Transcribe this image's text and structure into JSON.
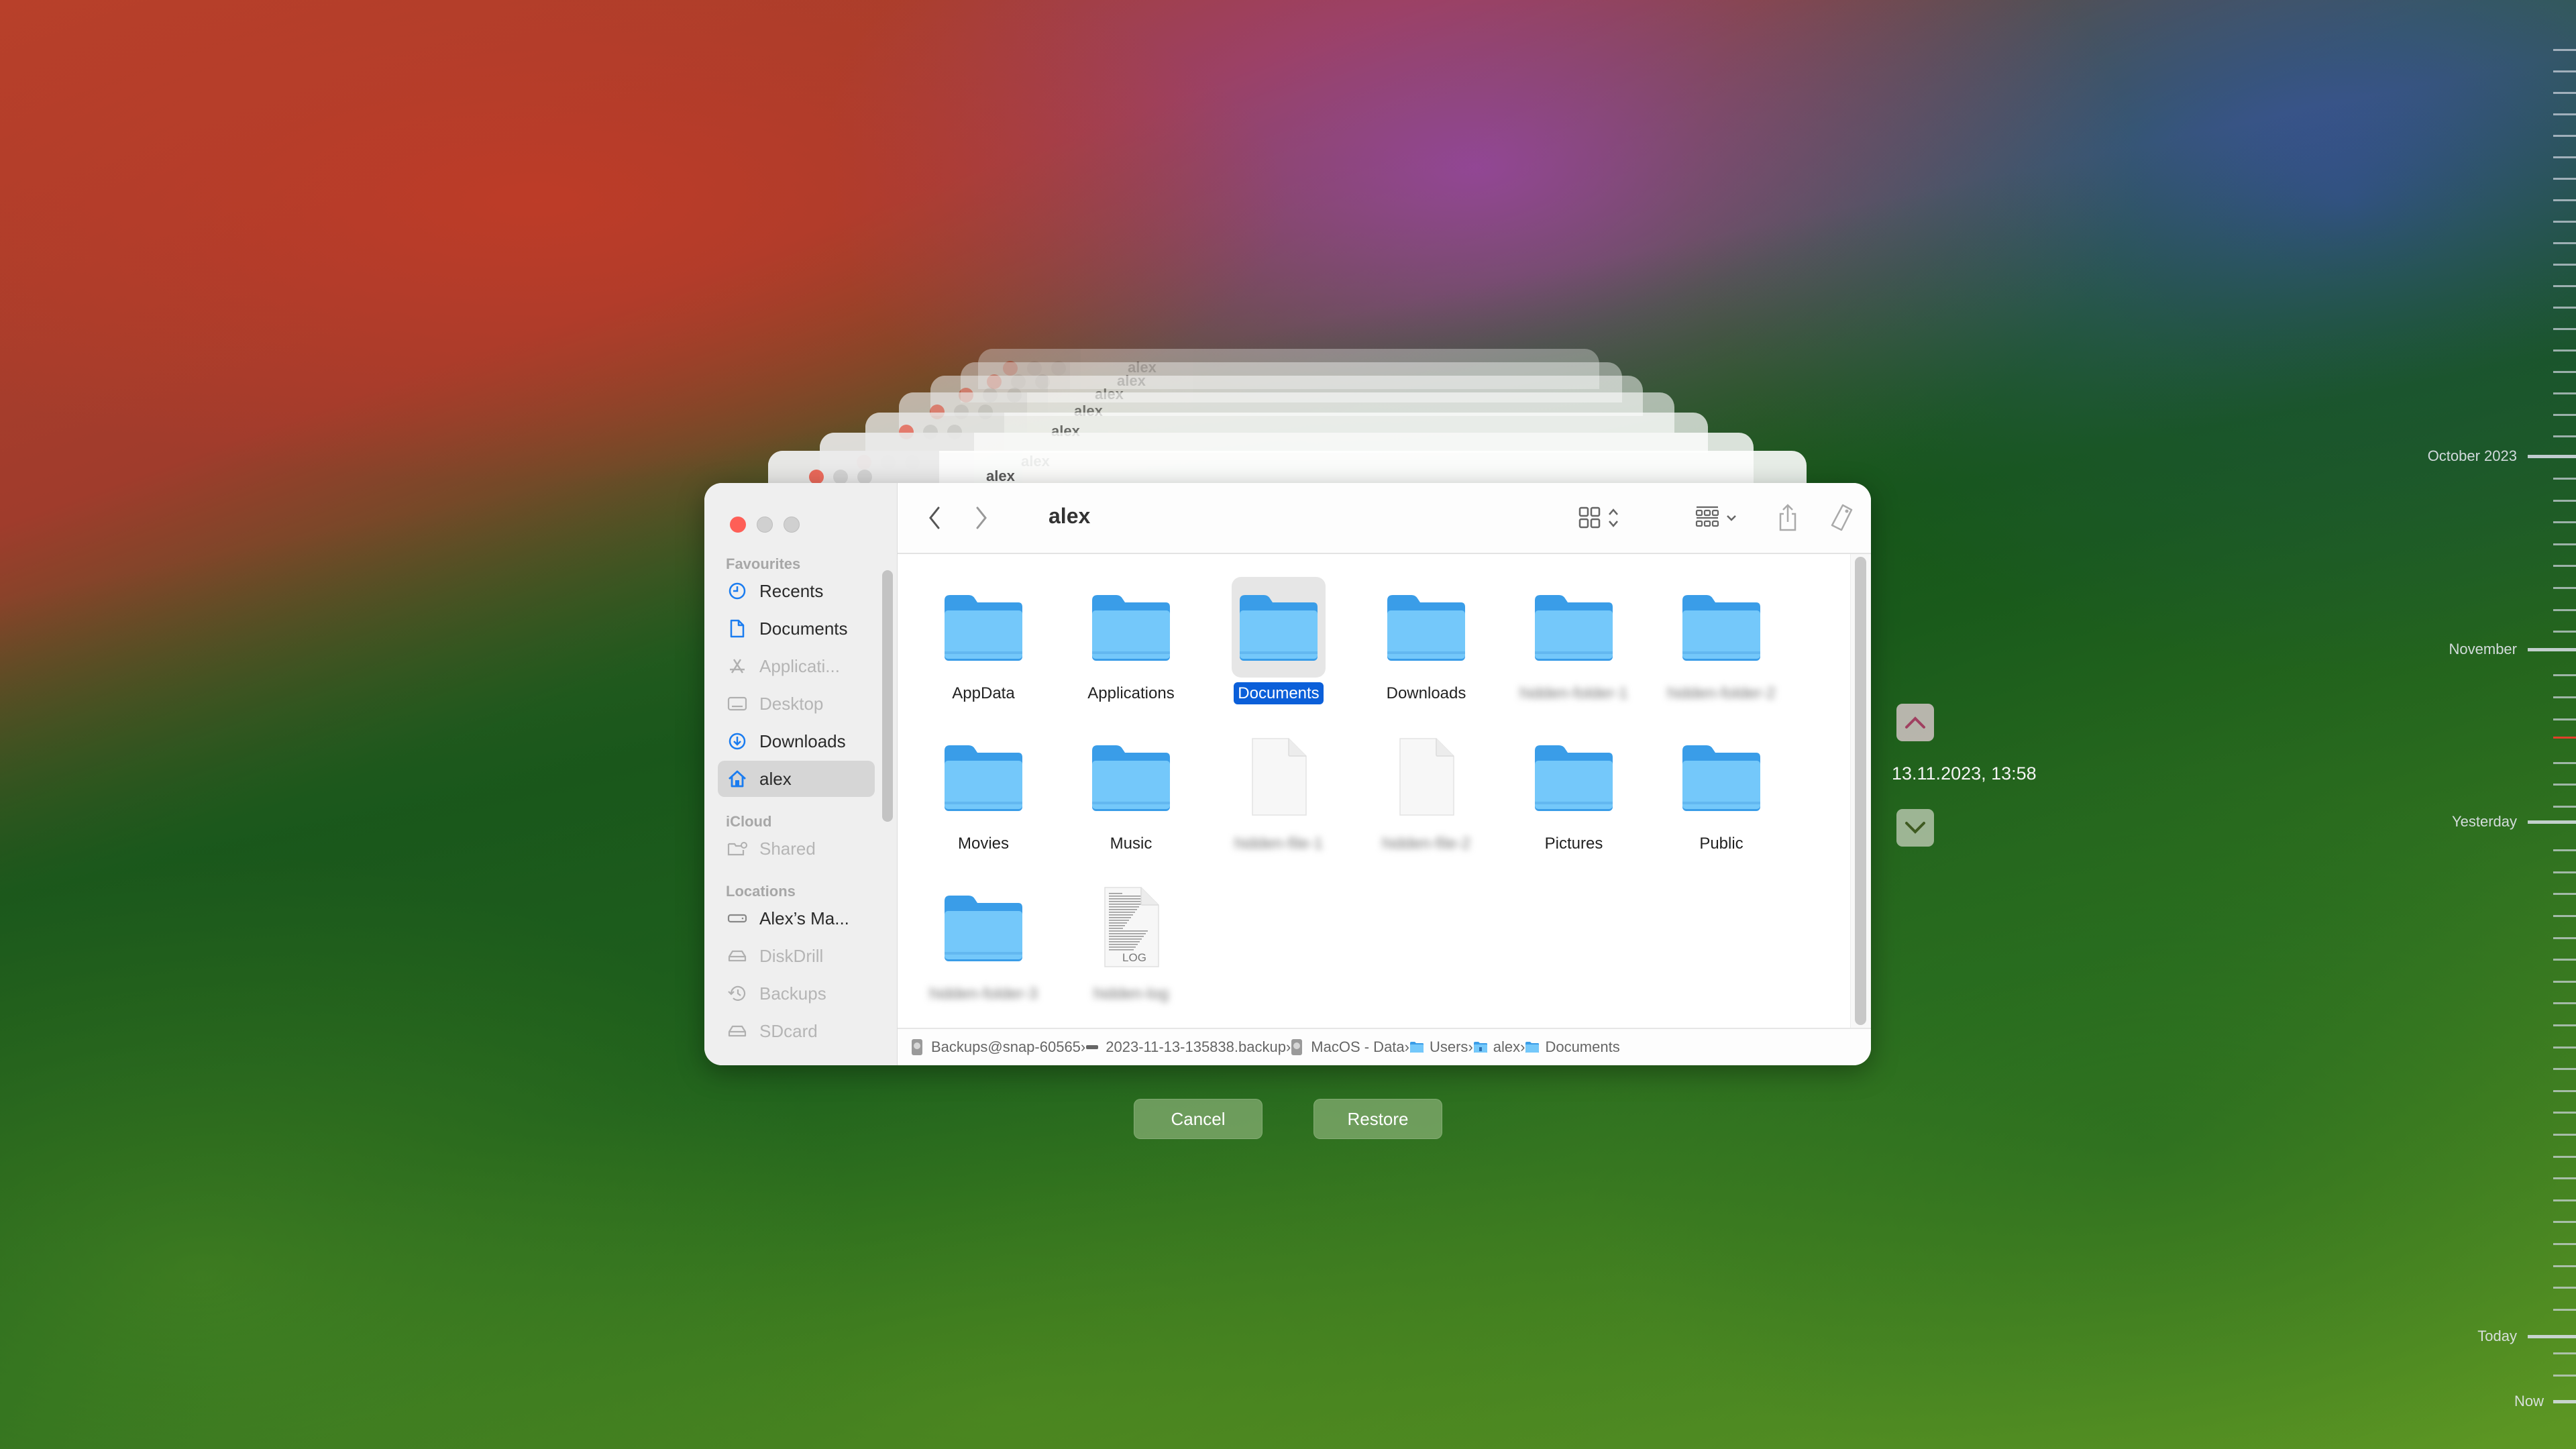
{
  "window": {
    "title": "alex",
    "sidebar": {
      "sections": [
        {
          "label": "Favourites",
          "items": [
            {
              "label": "Recents",
              "icon": "clock-icon",
              "dim": false,
              "selected": false
            },
            {
              "label": "Documents",
              "icon": "document-icon",
              "dim": false,
              "selected": false
            },
            {
              "label": "Applicati...",
              "icon": "applications-icon",
              "dim": true,
              "selected": false
            },
            {
              "label": "Desktop",
              "icon": "desktop-icon",
              "dim": true,
              "selected": false
            },
            {
              "label": "Downloads",
              "icon": "download-icon",
              "dim": false,
              "selected": false
            },
            {
              "label": "alex",
              "icon": "home-icon",
              "dim": false,
              "selected": true
            }
          ]
        },
        {
          "label": "iCloud",
          "items": [
            {
              "label": "Shared",
              "icon": "shared-folder-icon",
              "dim": true,
              "selected": false
            }
          ]
        },
        {
          "label": "Locations",
          "items": [
            {
              "label": "Alex’s Ma...",
              "icon": "computer-icon",
              "dim": false,
              "selected": false
            },
            {
              "label": "DiskDrill",
              "icon": "drive-icon",
              "dim": true,
              "selected": false
            },
            {
              "label": "Backups",
              "icon": "time-machine-icon",
              "dim": true,
              "selected": false
            },
            {
              "label": "SDcard",
              "icon": "drive-icon",
              "dim": true,
              "selected": false
            }
          ]
        }
      ]
    },
    "toolbar": {
      "back": "back-chevron-icon",
      "forward": "forward-chevron-icon",
      "view": "grid-view-icon",
      "group": "group-icon",
      "share": "share-icon",
      "tag": "tag-icon",
      "more": "more-icon",
      "search": "search-icon"
    },
    "items": [
      {
        "name": "AppData",
        "type": "folder",
        "blurred": false,
        "selected": false
      },
      {
        "name": "Applications",
        "type": "folder",
        "blurred": false,
        "selected": false
      },
      {
        "name": "Documents",
        "type": "folder",
        "blurred": false,
        "selected": true
      },
      {
        "name": "Downloads",
        "type": "folder",
        "blurred": false,
        "selected": false
      },
      {
        "name": "hidden-folder-1",
        "type": "folder",
        "blurred": true,
        "selected": false
      },
      {
        "name": "hidden-folder-2",
        "type": "folder",
        "blurred": true,
        "selected": false
      },
      {
        "name": "Movies",
        "type": "folder",
        "blurred": false,
        "selected": false
      },
      {
        "name": "Music",
        "type": "folder",
        "blurred": false,
        "selected": false
      },
      {
        "name": "hidden-file-1",
        "type": "file",
        "blurred": true,
        "selected": false
      },
      {
        "name": "hidden-file-2",
        "type": "file",
        "blurred": true,
        "selected": false
      },
      {
        "name": "Pictures",
        "type": "folder",
        "blurred": false,
        "selected": false
      },
      {
        "name": "Public",
        "type": "folder",
        "blurred": false,
        "selected": false
      },
      {
        "name": "hidden-folder-3",
        "type": "folder",
        "blurred": true,
        "selected": false
      },
      {
        "name": "hidden-log",
        "type": "log",
        "blurred": true,
        "selected": false,
        "badge": "LOG"
      }
    ],
    "pathbar": [
      {
        "label": "Backups@snap-60565",
        "icon": "disk-icon"
      },
      {
        "label": "2023-11-13-135838.backup",
        "icon": "drive-small-icon"
      },
      {
        "label": "MacOS - Data",
        "icon": "disk-icon"
      },
      {
        "label": "Users",
        "icon": "folder-small-icon"
      },
      {
        "label": "alex",
        "icon": "home-folder-icon"
      },
      {
        "label": "Documents",
        "icon": "folder-small-icon"
      }
    ]
  },
  "actions": {
    "cancel": "Cancel",
    "restore": "Restore"
  },
  "snapshot": {
    "date": "13.11.2023, 13:58"
  },
  "timeline": {
    "labels": [
      "October 2023",
      "November",
      "Yesterday",
      "Today",
      "Now"
    ],
    "current_color": "#e0402a"
  },
  "stack": {
    "title": "alex",
    "count": 7
  }
}
